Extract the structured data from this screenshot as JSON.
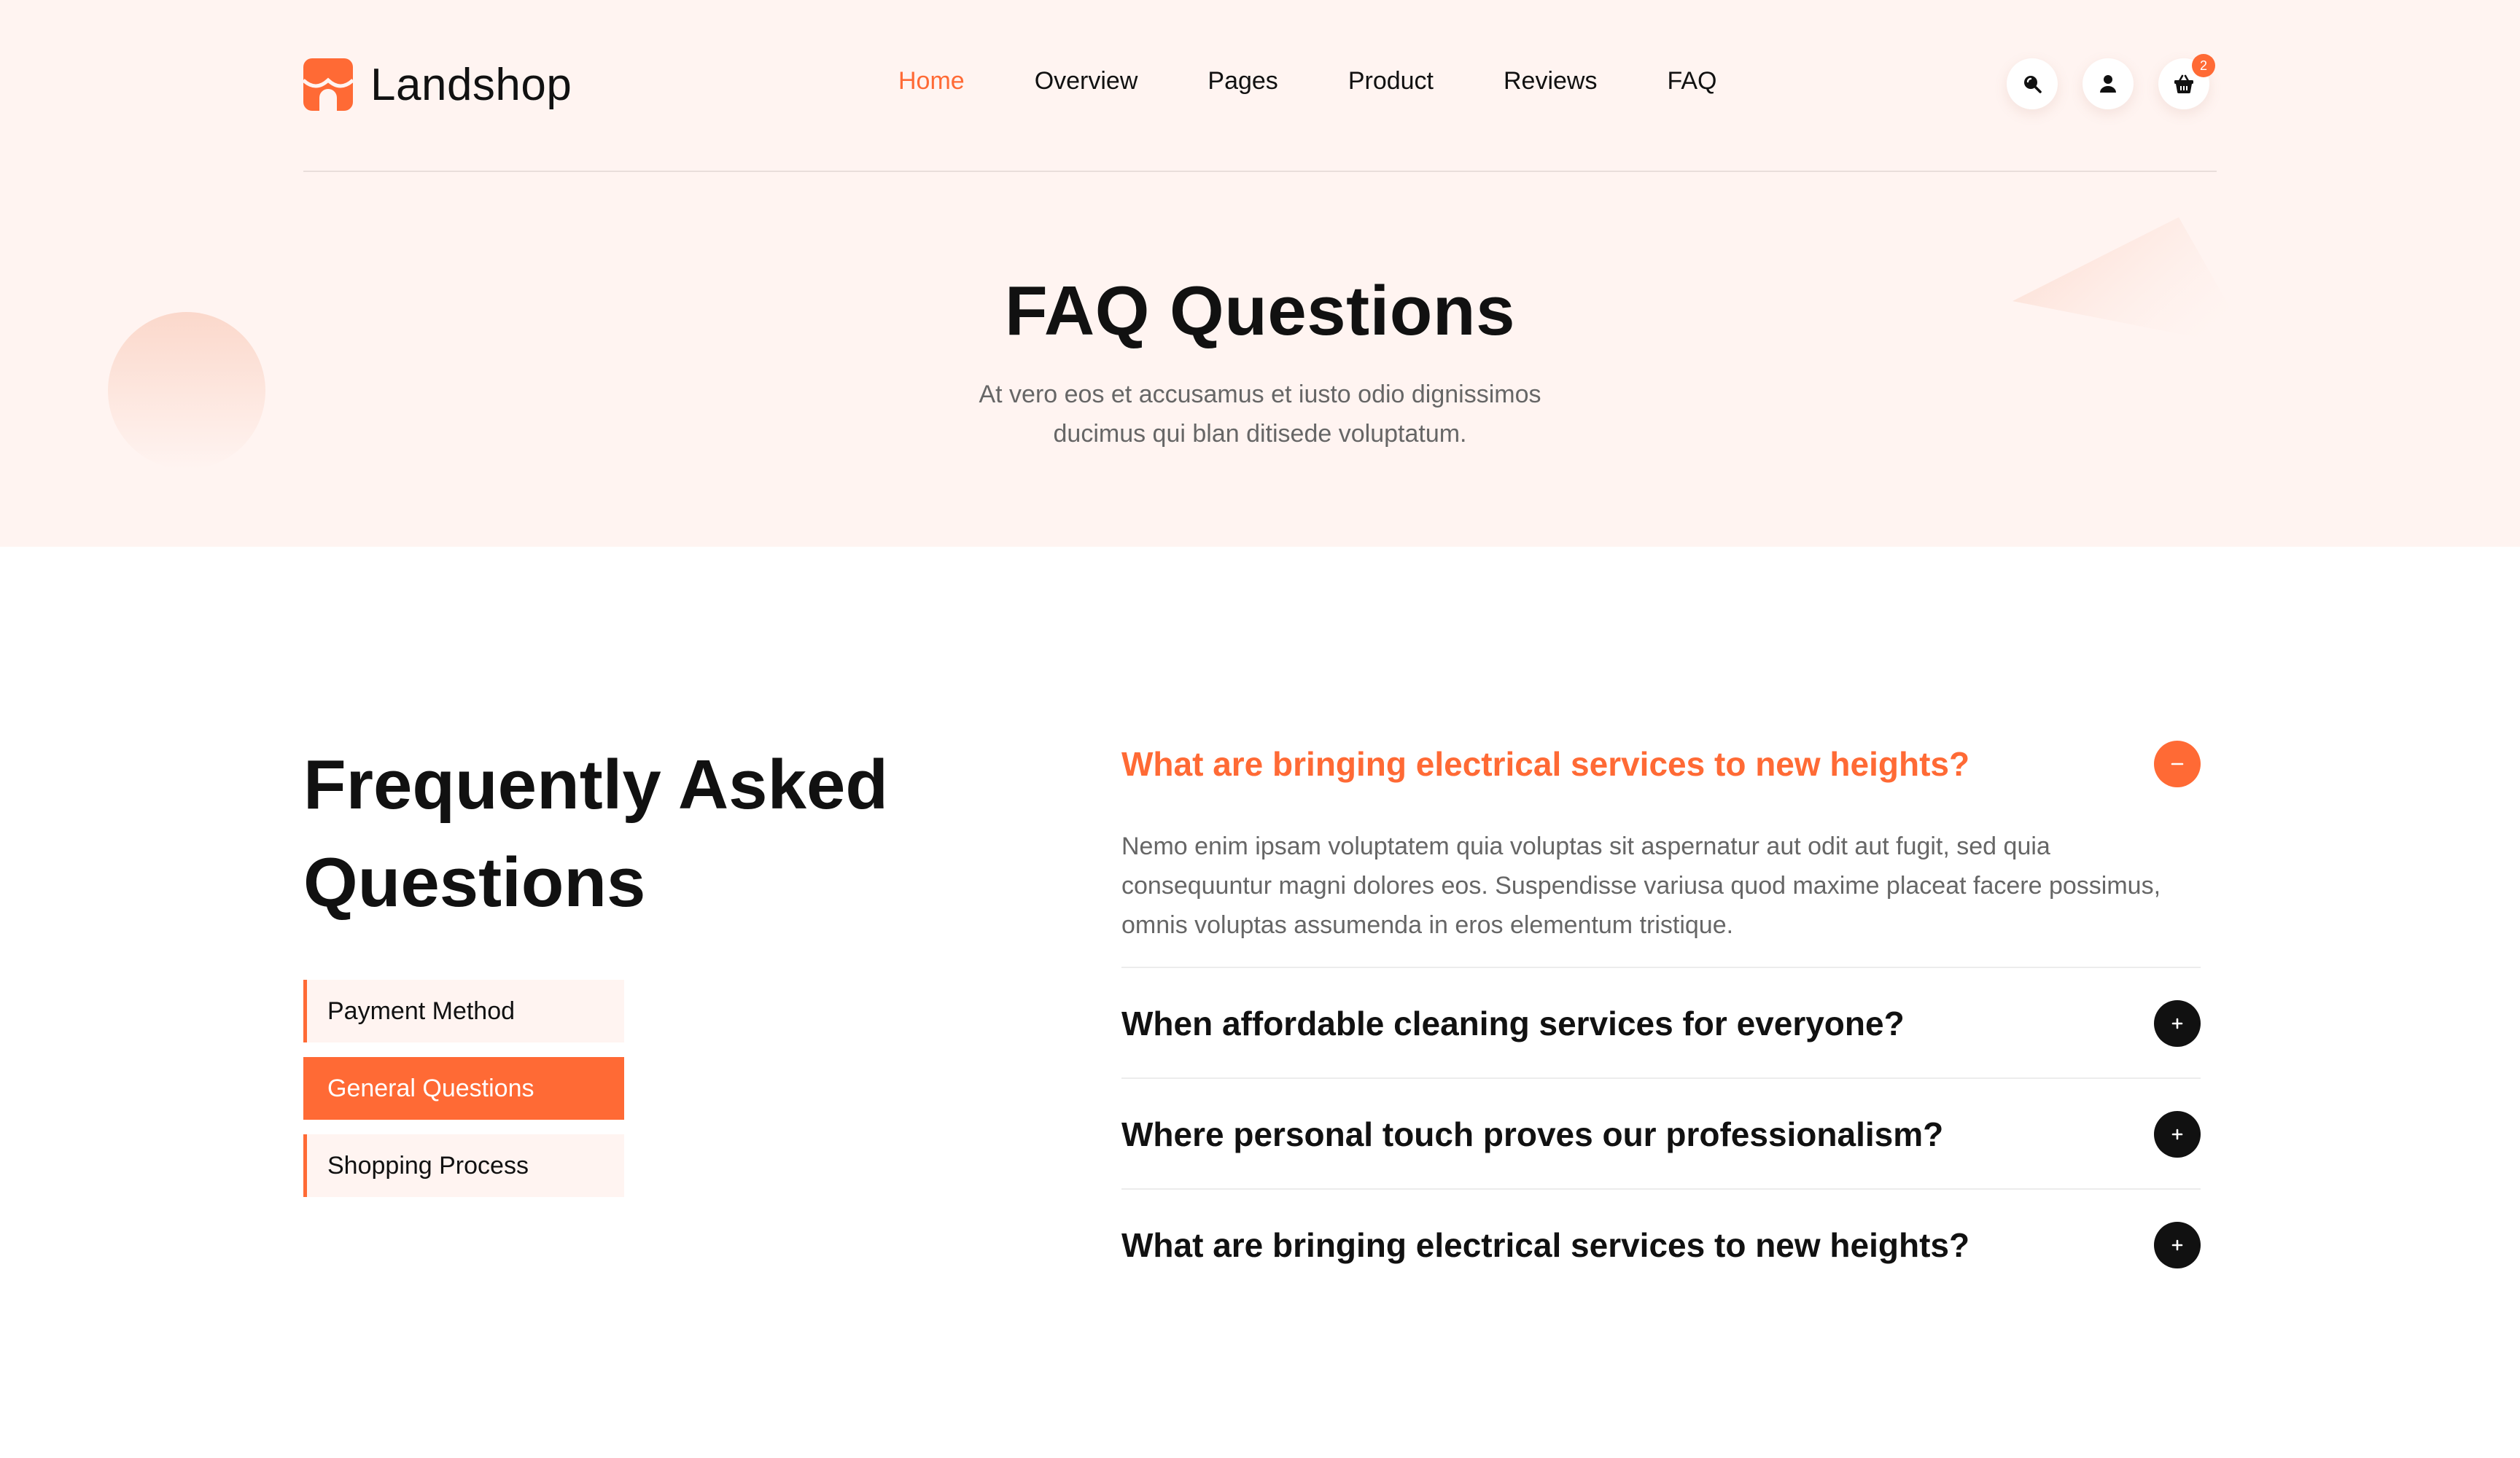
{
  "brand": {
    "name": "Landshop"
  },
  "nav": {
    "items": [
      {
        "label": "Home",
        "active": true
      },
      {
        "label": "Overview",
        "active": false
      },
      {
        "label": "Pages",
        "active": false
      },
      {
        "label": "Product",
        "active": false
      },
      {
        "label": "Reviews",
        "active": false
      },
      {
        "label": "FAQ",
        "active": false
      }
    ]
  },
  "header_icons": {
    "search": "search-icon",
    "account": "user-icon",
    "cart": "basket-icon",
    "cart_count": "2"
  },
  "hero": {
    "title": "FAQ Questions",
    "subtitle_line1": "At vero eos et accusamus et iusto odio dignissimos",
    "subtitle_line2": "ducimus qui blan ditisede voluptatum."
  },
  "faq": {
    "heading_line1": "Frequently Asked",
    "heading_line2": "Questions",
    "categories": [
      {
        "label": "Payment Method",
        "active": false
      },
      {
        "label": "General Questions",
        "active": true
      },
      {
        "label": "Shopping Process",
        "active": false
      }
    ],
    "items": [
      {
        "question": "What are bringing electrical services to new heights?",
        "answer": "Nemo enim ipsam voluptatem quia voluptas sit aspernatur aut odit aut fugit, sed quia consequuntur magni dolores eos. Suspendisse variusa quod maxime placeat facere possimus, omnis voluptas assumenda in eros elementum tristique.",
        "open": true
      },
      {
        "question": "When affordable cleaning services for everyone?",
        "open": false
      },
      {
        "question": "Where personal touch proves our professionalism?",
        "open": false
      },
      {
        "question": "What are bringing electrical services to new heights?",
        "open": false
      }
    ]
  },
  "colors": {
    "accent": "#ff6a35",
    "hero_bg": "#fff4f1",
    "text_dark": "#111111",
    "text_muted": "#666666"
  }
}
